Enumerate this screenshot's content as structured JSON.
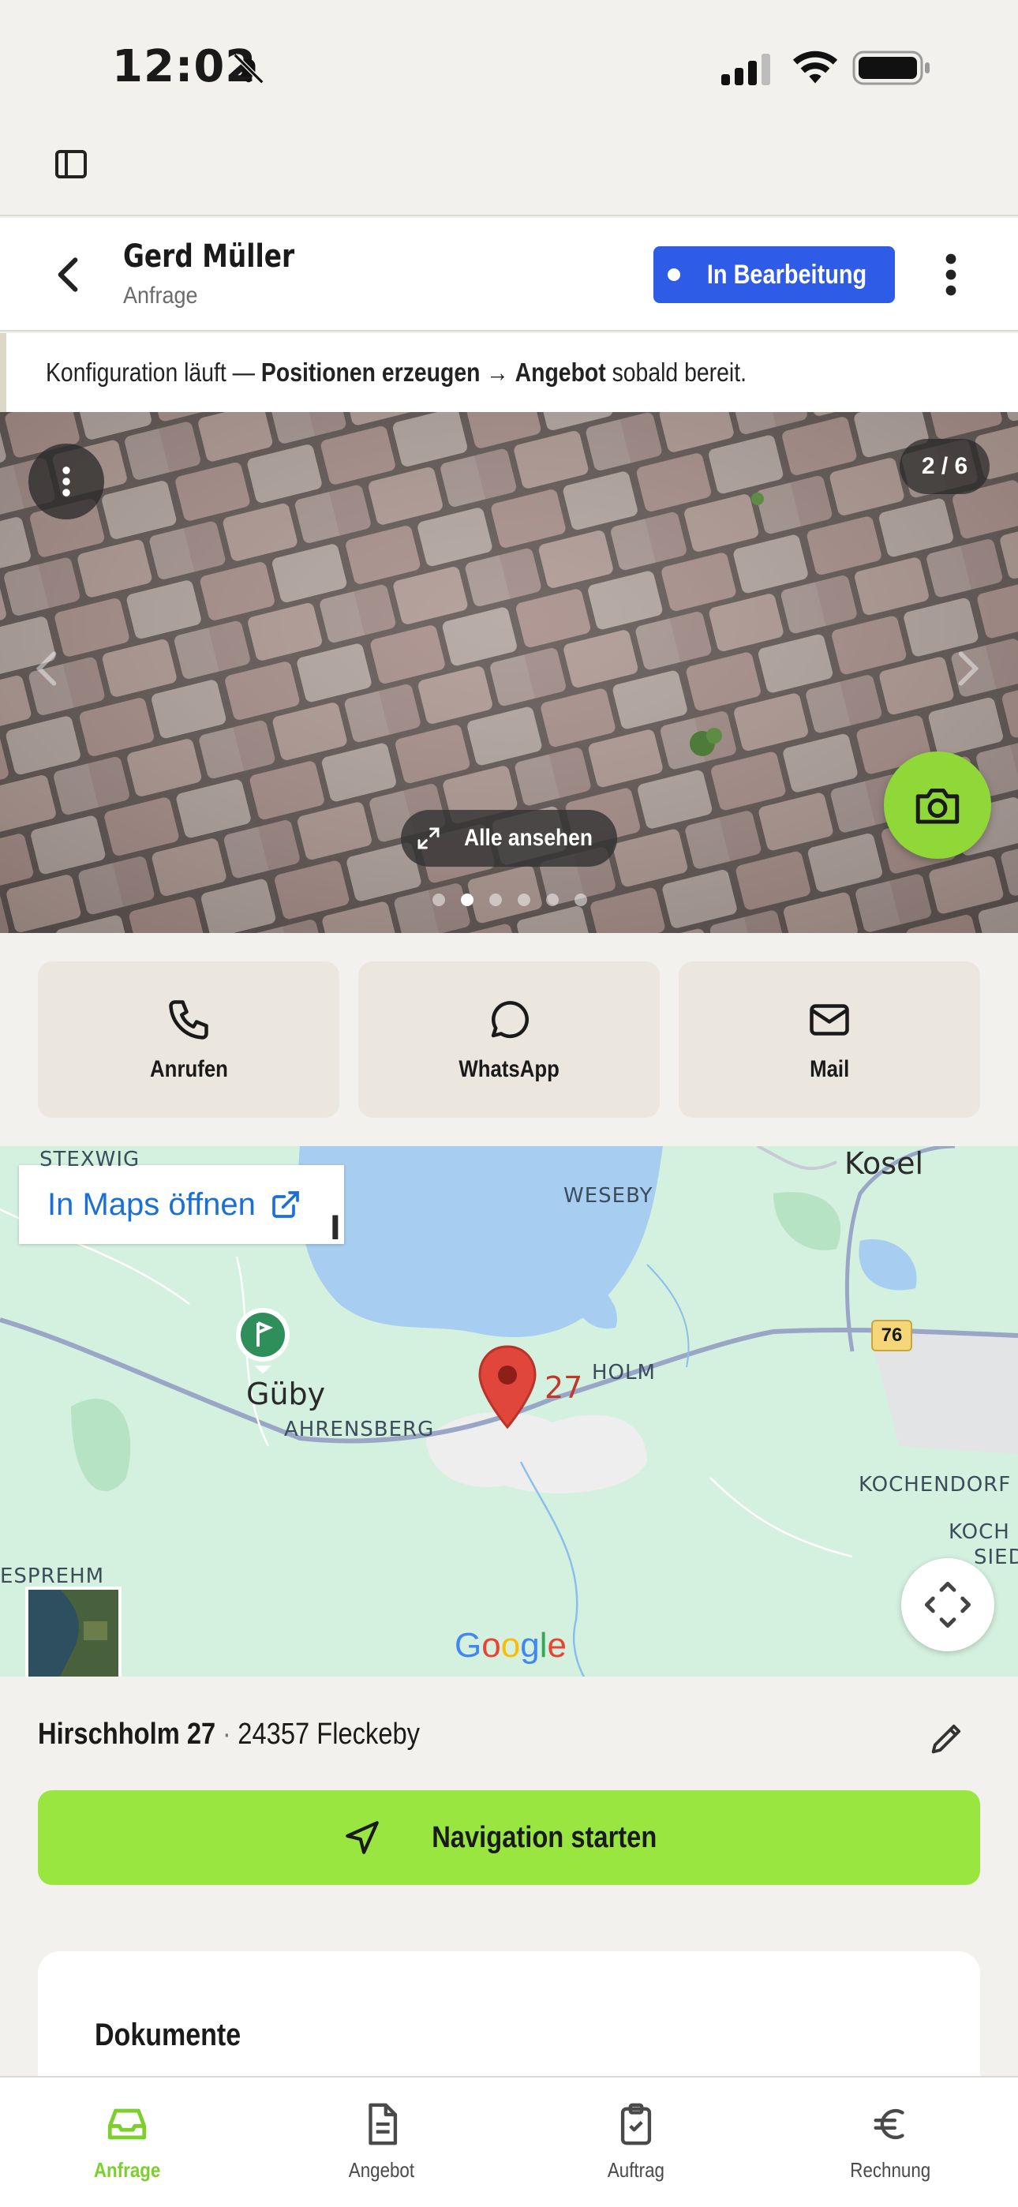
{
  "status_bar": {
    "time": "12:02"
  },
  "header": {
    "customer_name": "Gerd Müller",
    "subtitle": "Anfrage",
    "status_label": "In Bearbeitung"
  },
  "banner": {
    "prefix": "Konfiguration läuft — ",
    "step1": "Positionen erzeugen",
    "arrow": " → ",
    "step2": "Angebot",
    "suffix": " sobald bereit."
  },
  "gallery": {
    "counter": "2 / 6",
    "view_all_label": "Alle ansehen",
    "total_images": 6,
    "current_index": 2
  },
  "contact_actions": [
    {
      "label": "Anrufen",
      "icon": "phone-icon"
    },
    {
      "label": "WhatsApp",
      "icon": "chat-icon"
    },
    {
      "label": "Mail",
      "icon": "mail-icon"
    }
  ],
  "map": {
    "open_in_maps_label": "In Maps öffnen",
    "labels": {
      "stexwig": "STEXWIG",
      "weseby": "WESEBY",
      "kosel": "Kosel",
      "guby": "Güby",
      "ahrensberg": "AHRENSBERG",
      "holm": "HOLM",
      "kochendorf": "KOCHENDORF",
      "koch": "KOCH",
      "sied": "SIED",
      "esprehm": "ESPREHM",
      "marker_number": "27",
      "road_number": "76",
      "partial_l": "l"
    },
    "google_letters": [
      "G",
      "o",
      "o",
      "g",
      "l",
      "e"
    ]
  },
  "address": {
    "street": "Hirschholm 27",
    "separator": "·",
    "city": "24357 Fleckeby"
  },
  "navigation_label": "Navigation starten",
  "documents": {
    "title": "Dokumente"
  },
  "tabs": [
    {
      "label": "Anfrage",
      "active": true
    },
    {
      "label": "Angebot",
      "active": false
    },
    {
      "label": "Auftrag",
      "active": false
    },
    {
      "label": "Rechnung",
      "active": false
    }
  ],
  "colors": {
    "accent_green": "#9ae641",
    "status_blue": "#2f5ce6",
    "link_blue": "#1a6fd8",
    "tab_active": "#7ccf2c"
  }
}
